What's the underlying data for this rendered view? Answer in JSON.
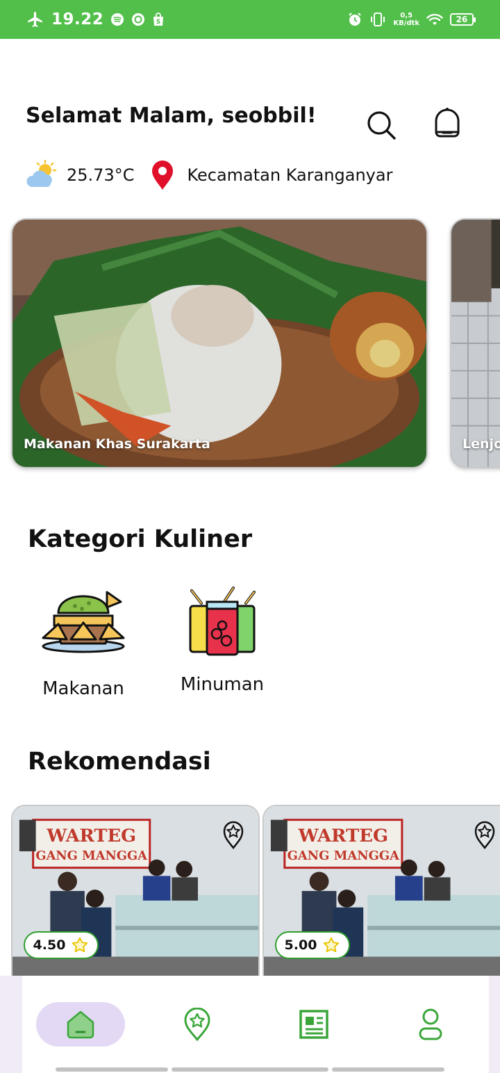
{
  "status_bar": {
    "time": "19.22",
    "speed_value": "0,5",
    "speed_unit": "KB/dtk",
    "battery": "26"
  },
  "header": {
    "greeting": "Selamat Malam, seobbil!",
    "temperature": "25.73°C",
    "location": "Kecamatan Karanganyar"
  },
  "carousel": [
    {
      "caption": "Makanan Khas Surakarta"
    },
    {
      "caption": "Lenjongan"
    }
  ],
  "categories": {
    "title": "Kategori Kuliner",
    "items": [
      {
        "label": "Makanan"
      },
      {
        "label": "Minuman"
      }
    ]
  },
  "recommendations": {
    "title": "Rekomendasi",
    "items": [
      {
        "rating": "4.50"
      },
      {
        "rating": "5.00"
      }
    ]
  },
  "colors": {
    "brand_green": "#52bf4a",
    "nav_active_bg": "#e3d9f4",
    "pin_red": "#e0102a"
  },
  "icons": {
    "search": "search-icon",
    "notifications": "bell-icon",
    "weather": "partly-cloudy-icon",
    "location": "map-pin-icon",
    "rating": "star-icon",
    "bookmark": "bookmark-star-icon",
    "nav": [
      "home-icon",
      "explore-pin-icon",
      "news-icon",
      "profile-icon"
    ]
  }
}
